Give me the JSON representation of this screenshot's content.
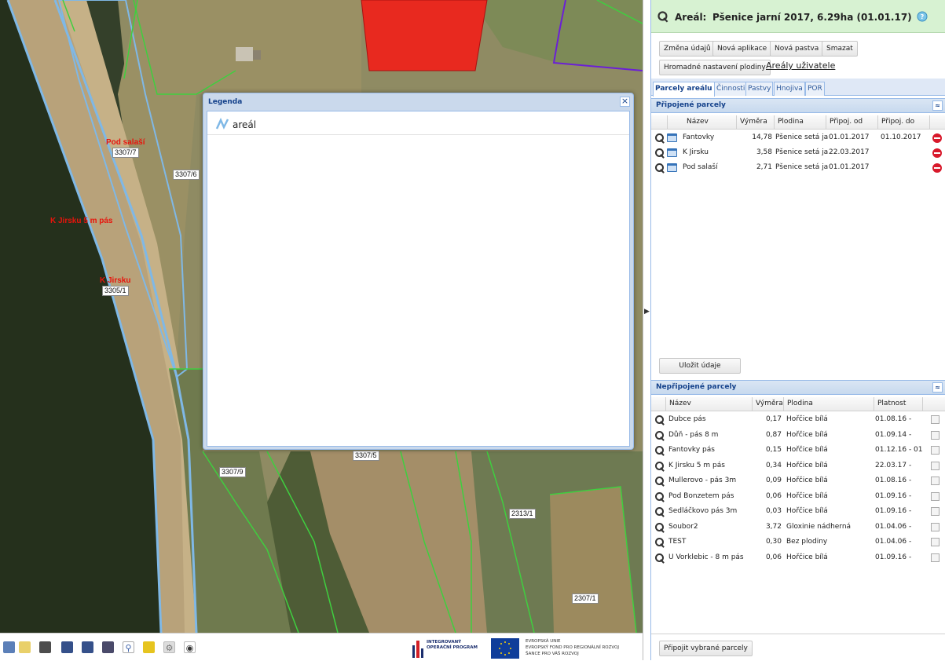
{
  "areal": {
    "label": "Areál:",
    "value": "Pšenice jarní 2017, 6.29ha (01.01.17)"
  },
  "buttons": {
    "zmena": "Změna údajů",
    "nova_aplikace": "Nová aplikace",
    "nova_pastva": "Nová pastva",
    "smazat": "Smazat",
    "hromadne": "Hromadné nastavení plodiny",
    "arealy_uzivatele": "Areály uživatele",
    "ulozit": "Uložit údaje",
    "pripojit": "Připojit vybrané parcely"
  },
  "tabs": [
    "Parcely areálu",
    "Činnosti",
    "Pastvy",
    "Hnojiva",
    "POR"
  ],
  "connected": {
    "title": "Připojené parcely",
    "columns": [
      "Název",
      "Výměra",
      "Plodina",
      "Připoj. od",
      "Připoj. do"
    ],
    "rows": [
      {
        "name": "Fantovky",
        "area": "14,78",
        "crop": "Pšenice setá ja...",
        "from": "01.01.2017",
        "to": "01.10.2017"
      },
      {
        "name": "K Jirsku",
        "area": "3,58",
        "crop": "Pšenice setá ja...",
        "from": "22.03.2017",
        "to": ""
      },
      {
        "name": "Pod salaší",
        "area": "2,71",
        "crop": "Pšenice setá ja...",
        "from": "01.01.2017",
        "to": ""
      }
    ]
  },
  "unconnected": {
    "title": "Nepřipojené parcely",
    "columns": [
      "Název",
      "Výměra",
      "Plodina",
      "Platnost"
    ],
    "rows": [
      {
        "name": "Dubce pás",
        "area": "0,17",
        "crop": "Hořčice bílá",
        "valid": "01.08.16 -"
      },
      {
        "name": "Důň - pás 8 m",
        "area": "0,87",
        "crop": "Hořčice bílá",
        "valid": "01.09.14 -"
      },
      {
        "name": "Fantovky pás",
        "area": "0,15",
        "crop": "Hořčice bílá",
        "valid": "01.12.16 - 01..."
      },
      {
        "name": "K Jirsku 5 m pás",
        "area": "0,34",
        "crop": "Hořčice bílá",
        "valid": "22.03.17 -"
      },
      {
        "name": "Mullerovo - pás 3m",
        "area": "0,09",
        "crop": "Hořčice bílá",
        "valid": "01.08.16 -"
      },
      {
        "name": "Pod Bonzetem pás",
        "area": "0,06",
        "crop": "Hořčice bílá",
        "valid": "01.09.16 -"
      },
      {
        "name": "Sedláčkovo pás 3m",
        "area": "0,03",
        "crop": "Hořčice bílá",
        "valid": "01.09.16 -"
      },
      {
        "name": "Soubor2",
        "area": "3,72",
        "crop": "Gloxinie nádherná",
        "valid": "01.04.06 -"
      },
      {
        "name": "TEST",
        "area": "0,30",
        "crop": "Bez plodiny",
        "valid": "01.04.06 -"
      },
      {
        "name": "U Vorklebic - 8 m pás",
        "area": "0,06",
        "crop": "Hořčice bílá",
        "valid": "01.09.16 -"
      }
    ]
  },
  "legend": {
    "title": "Legenda",
    "entry": "areál"
  },
  "map_labels": {
    "pod_salasi": "Pod salaší",
    "p3307_7": "3307/7",
    "p3307_6": "3307/6",
    "k_jirsku_5m": "K Jirsku 5 m pás",
    "k_jirsku": "K Jirsku",
    "p3305_1": "3305/1",
    "p3307_5": "3307/5",
    "p3307_9": "3307/9",
    "p2313_1": "2313/1",
    "p2307_1": "2307/1"
  },
  "logos": {
    "iop_text": "INTEGROVANÝ OPERAČNÍ PROGRAM",
    "eu_line1": "EVROPSKÁ UNIE",
    "eu_line2": "EVROPSKÝ FOND PRO REGIONÁLNÍ ROZVOJ",
    "eu_line3": "ŠANCE PRO VÁŠ ROZVOJ"
  },
  "colors": {
    "header_bg": "#d7f2d2",
    "panel_title": "#15428b",
    "areal_line": "#7fb8e6",
    "parcel_line": "#3fcf3f",
    "red_polygon": "#e8291f",
    "purple_line": "#6b1fd6"
  }
}
